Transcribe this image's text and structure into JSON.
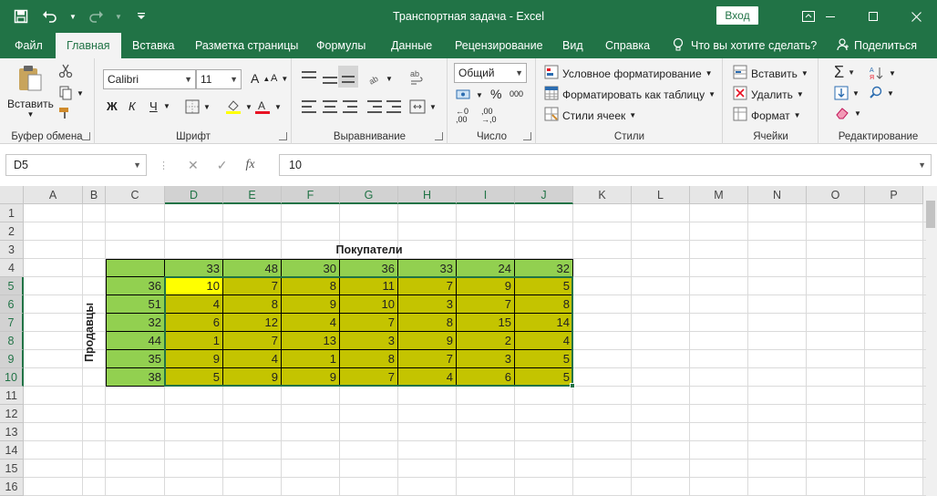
{
  "window": {
    "title": "Транспортная задача  -  Excel",
    "login_label": "Вход"
  },
  "tabs": [
    {
      "label": "Файл"
    },
    {
      "label": "Главная"
    },
    {
      "label": "Вставка"
    },
    {
      "label": "Разметка страницы"
    },
    {
      "label": "Формулы"
    },
    {
      "label": "Данные"
    },
    {
      "label": "Рецензирование"
    },
    {
      "label": "Вид"
    },
    {
      "label": "Справка"
    }
  ],
  "tell_me": "Что вы хотите сделать?",
  "share": "Поделиться",
  "ribbon": {
    "clipboard": {
      "label": "Буфер обмена",
      "paste": "Вставить"
    },
    "font": {
      "label": "Шрифт",
      "name": "Calibri",
      "size": "11",
      "bold": "Ж",
      "italic": "К",
      "underline": "Ч"
    },
    "alignment": {
      "label": "Выравнивание"
    },
    "number": {
      "label": "Число",
      "format": "Общий"
    },
    "styles": {
      "label": "Стили",
      "conditional": "Условное форматирование",
      "as_table": "Форматировать как таблицу",
      "cell_styles": "Стили ячеек"
    },
    "cells": {
      "label": "Ячейки",
      "insert": "Вставить",
      "delete": "Удалить",
      "format": "Формат"
    },
    "editing": {
      "label": "Редактирование"
    }
  },
  "formula_bar": {
    "name_box": "D5",
    "fx": "fx",
    "value": "10"
  },
  "columns": [
    "A",
    "B",
    "C",
    "D",
    "E",
    "F",
    "G",
    "H",
    "I",
    "J",
    "K",
    "L",
    "M",
    "N",
    "O",
    "P"
  ],
  "rows": [
    "1",
    "2",
    "3",
    "4",
    "5",
    "6",
    "7",
    "8",
    "9",
    "10",
    "11",
    "12",
    "13",
    "14",
    "15",
    "16"
  ],
  "sheet": {
    "buyers_title": "Покупатели",
    "sellers_title": "Продавцы",
    "demand": [
      "33",
      "48",
      "30",
      "36",
      "33",
      "24",
      "32"
    ],
    "supply": [
      "36",
      "51",
      "32",
      "44",
      "35",
      "38"
    ],
    "costs": [
      [
        "10",
        "7",
        "8",
        "11",
        "7",
        "9",
        "5"
      ],
      [
        "4",
        "8",
        "9",
        "10",
        "3",
        "7",
        "8"
      ],
      [
        "6",
        "12",
        "4",
        "7",
        "8",
        "15",
        "14"
      ],
      [
        "1",
        "7",
        "13",
        "3",
        "9",
        "2",
        "4"
      ],
      [
        "9",
        "4",
        "1",
        "8",
        "7",
        "3",
        "5"
      ],
      [
        "5",
        "9",
        "9",
        "7",
        "4",
        "6",
        "5"
      ]
    ]
  },
  "colors": {
    "accent": "#217346",
    "demand_fill": "#92d050",
    "cost_fill": "#c4c400",
    "active_fill": "#ffff00"
  }
}
